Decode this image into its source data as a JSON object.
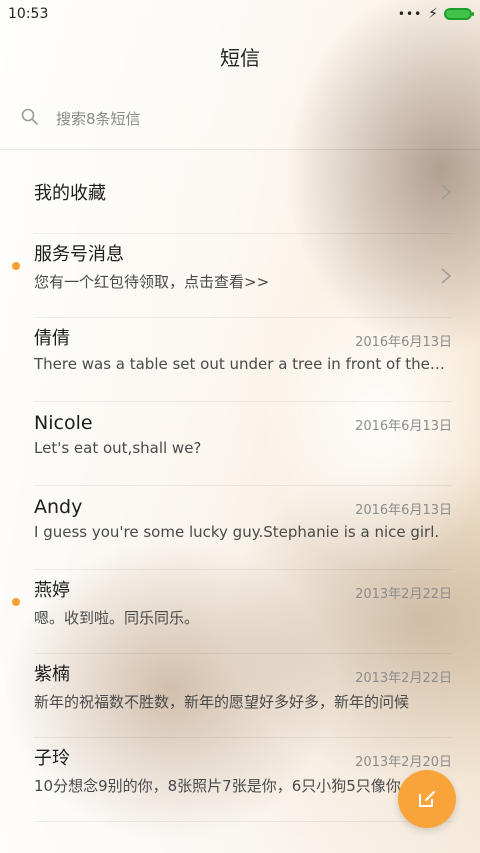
{
  "status": {
    "time": "10:53",
    "signal": "•••",
    "charging_glyph": "⚡",
    "battery_color": "#41c24b"
  },
  "header": {
    "title": "短信"
  },
  "search": {
    "placeholder": "搜索8条短信",
    "icon": "search-icon"
  },
  "list": {
    "items": [
      {
        "title": "我的收藏",
        "type": "folder",
        "chevron": true
      },
      {
        "title": "服务号消息",
        "subtitle": "您有一个红包待领取，点击查看>>",
        "unread": true,
        "type": "folder",
        "chevron": true
      },
      {
        "title": "倩倩",
        "date": "2016年6月13日",
        "subtitle": "There was a table set out under a tree in front of the house"
      },
      {
        "title": "Nicole",
        "date": "2016年6月13日",
        "subtitle": "Let's eat out,shall we?"
      },
      {
        "title": "Andy",
        "date": "2016年6月13日",
        "subtitle": "I guess you're some lucky guy.Stephanie is a nice girl."
      },
      {
        "title": "燕婷",
        "date": "2013年2月22日",
        "subtitle": "嗯。收到啦。同乐同乐。",
        "unread": true
      },
      {
        "title": "紫楠",
        "date": "2013年2月22日",
        "subtitle": "新年的祝福数不胜数，新年的愿望好多好多，新年的问候"
      },
      {
        "title": "子玲",
        "date": "2013年2月20日",
        "subtitle": "10分想念9别的你，8张照片7张是你，6只小狗5只像你"
      }
    ]
  },
  "fab": {
    "icon": "compose-icon",
    "color": "#f8a43a"
  },
  "accent_color": "#f6a032"
}
